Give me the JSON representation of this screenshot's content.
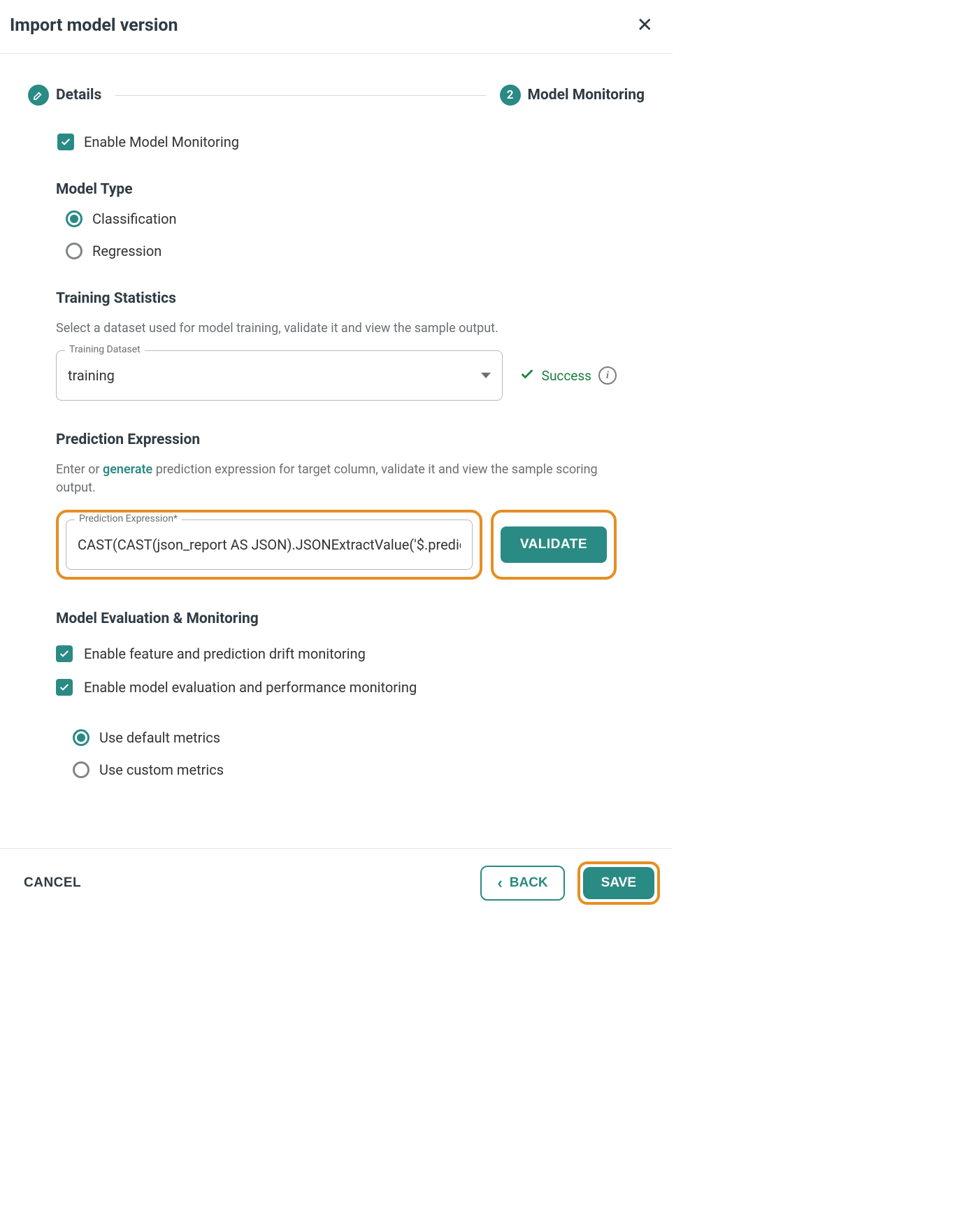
{
  "dialog": {
    "title": "Import model version"
  },
  "stepper": {
    "step1": {
      "label": "Details"
    },
    "step2": {
      "num": "2",
      "label": "Model Monitoring"
    }
  },
  "enable_monitoring": {
    "label": "Enable Model Monitoring"
  },
  "model_type": {
    "title": "Model Type",
    "options": {
      "classification": "Classification",
      "regression": "Regression"
    }
  },
  "training_stats": {
    "title": "Training Statistics",
    "desc": "Select a dataset used for model training, validate it and view the sample output.",
    "field_label": "Training Dataset",
    "value": "training",
    "status": "Success"
  },
  "prediction_expr": {
    "title": "Prediction Expression",
    "desc_pre": "Enter or ",
    "desc_link": "generate",
    "desc_post": " prediction expression for target column, validate it and view the sample scoring output.",
    "field_label": "Prediction Expression*",
    "value": "CAST(CAST(json_report AS JSON).JSONExtractValue('$.predicted_Ha",
    "validate_btn": "VALIDATE"
  },
  "evaluation": {
    "title": "Model Evaluation & Monitoring",
    "drift": "Enable feature and prediction drift monitoring",
    "perf": "Enable model evaluation and performance monitoring",
    "metrics": {
      "default": "Use default metrics",
      "custom": "Use custom metrics"
    }
  },
  "footer": {
    "cancel": "CANCEL",
    "back": "BACK",
    "save": "SAVE"
  }
}
